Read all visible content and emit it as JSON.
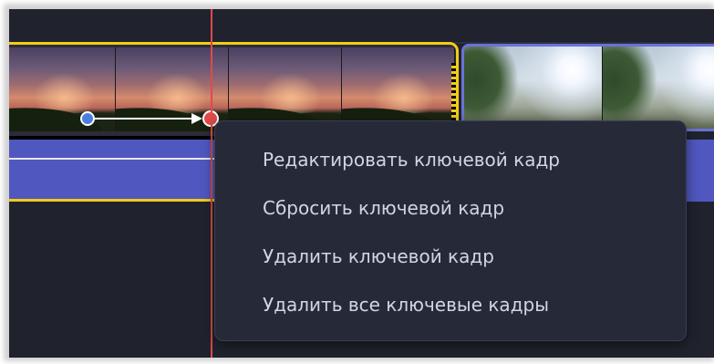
{
  "context_menu": {
    "items": [
      {
        "label": "Редактировать ключевой кадр"
      },
      {
        "label": "Сбросить ключевой кадр"
      },
      {
        "label": "Удалить ключевой кадр"
      },
      {
        "label": "Удалить все ключевые кадры"
      }
    ]
  },
  "colors": {
    "timeline_background": "#20232e",
    "selected_clip_border": "#f2cc18",
    "unselected_clip_border": "#6a72d6",
    "audio_track": "#5058c0",
    "playhead": "#e04a4a",
    "keyframe_start": "#4a7fe0",
    "keyframe_end": "#e04a4a",
    "menu_background": "#262a38",
    "menu_text": "#d2d6e0"
  },
  "icons": {
    "keyframe_start": "keyframe-start-icon",
    "keyframe_end": "keyframe-end-icon",
    "keyframe_arrow": "arrow-right-icon"
  }
}
